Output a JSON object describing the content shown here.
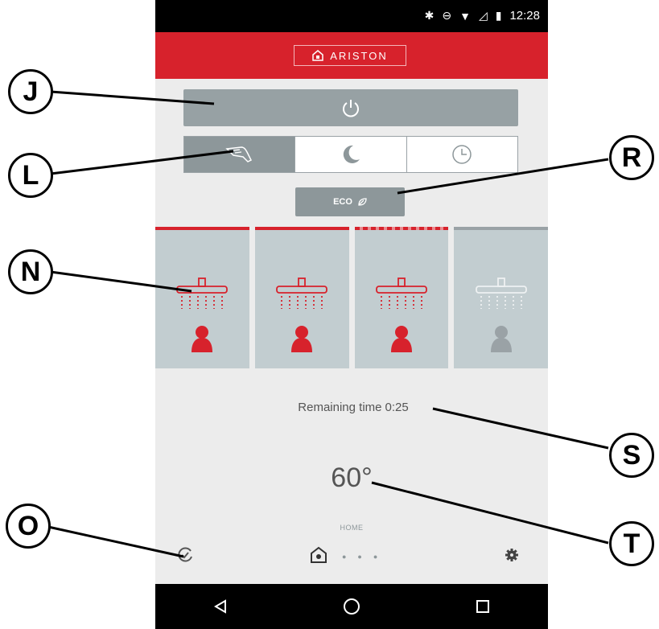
{
  "status_bar": {
    "time": "12:28"
  },
  "header": {
    "brand": "ARISTON"
  },
  "eco": {
    "label": "ECO"
  },
  "showers": [
    {
      "state": "active"
    },
    {
      "state": "active"
    },
    {
      "state": "partial"
    },
    {
      "state": "inactive"
    }
  ],
  "remaining": {
    "label": "Remaining time",
    "value": "0:25"
  },
  "temperature": {
    "value": "60°"
  },
  "bottom_nav": {
    "home_label": "HOME"
  },
  "callouts": {
    "J": "J",
    "L": "L",
    "N": "N",
    "O": "O",
    "R": "R",
    "S": "S",
    "T": "T"
  },
  "colors": {
    "brand_red": "#d7222c",
    "grey": "#8d979a",
    "panel": "#c2cdd0"
  }
}
